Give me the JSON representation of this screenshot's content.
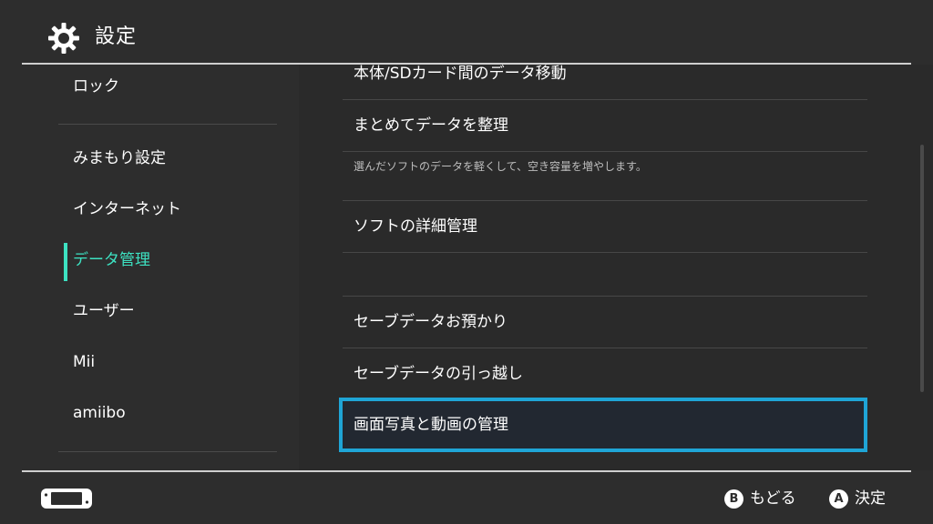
{
  "header": {
    "title": "設定",
    "icon": "gear-icon"
  },
  "sidebar": {
    "items": [
      {
        "label": "ロック"
      },
      {
        "label": "みまもり設定"
      },
      {
        "label": "インターネット"
      },
      {
        "label": "データ管理",
        "active": true
      },
      {
        "label": "ユーザー"
      },
      {
        "label": "Mii"
      },
      {
        "label": "amiibo"
      }
    ]
  },
  "main": {
    "rows": [
      {
        "label": "本体/SDカード間のデータ移動"
      },
      {
        "label": "まとめてデータを整理",
        "description": "選んだソフトのデータを軽くして、空き容量を増やします。"
      },
      {
        "label": "ソフトの詳細管理"
      },
      {
        "label": "セーブデータお預かり"
      },
      {
        "label": "セーブデータの引っ越し"
      },
      {
        "label": "画面写真と動画の管理",
        "selected": true
      }
    ]
  },
  "footer": {
    "console_icon": "console-icon",
    "back": {
      "button": "B",
      "label": "もどる"
    },
    "confirm": {
      "button": "A",
      "label": "決定"
    }
  },
  "colors": {
    "background": "#2d2d2d",
    "accent": "#3de2c2",
    "selection_border": "#1fa5d6",
    "text": "#ffffff",
    "subtext": "#bdbdbd"
  }
}
